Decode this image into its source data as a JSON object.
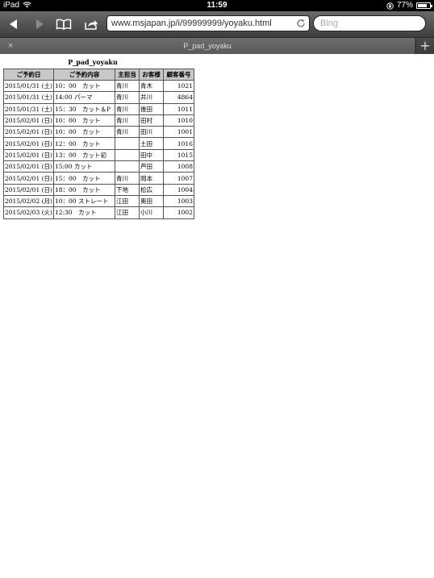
{
  "status_bar": {
    "device": "iPad",
    "time": "11:59",
    "battery": "77%",
    "battery_level_percent": 77
  },
  "toolbar": {
    "url": "www.msjapan.jp/i/99999999/yoyaku.html",
    "search_placeholder": "Bing"
  },
  "tabs": {
    "close": "×",
    "active_title": "P_pad_yoyaku",
    "add": "+"
  },
  "page": {
    "title": "P_pad_yoyaku",
    "columns": [
      "ご予約日",
      "ご予約内容",
      "主担当",
      "お客様",
      "顧客番号"
    ],
    "rows": [
      [
        "2015/01/31 (土)",
        "10：00　カット",
        "青川",
        "青木",
        "1021"
      ],
      [
        "2015/01/31 (土)",
        "14:00 パーマ",
        "青川",
        "井川",
        "4864"
      ],
      [
        "2015/01/31 (土)",
        "15：30　カット＆P",
        "青川",
        "後田",
        "1011"
      ],
      [
        "2015/02/01 (日)",
        "10：00　カット",
        "青川",
        "田村",
        "1010"
      ],
      [
        "2015/02/01 (日)",
        "10：00　カット",
        "青川",
        "田川",
        "1001"
      ],
      [
        "2015/02/01 (日)",
        "12：00　カット",
        "",
        "土田",
        "1016"
      ],
      [
        "2015/02/01 (日)",
        "13：00　カット初",
        "",
        "田中",
        "1015"
      ],
      [
        "2015/02/01 (日)",
        "15:00 カット",
        "",
        "芦田",
        "1008"
      ],
      [
        "2015/02/01 (日)",
        "15：00　カット",
        "青川",
        "岡本",
        "1007"
      ],
      [
        "2015/02/01 (日)",
        "18：00　カット",
        "下地",
        "松広",
        "1004"
      ],
      [
        "2015/02/02 (月)",
        "10：00 ストレート",
        "江田",
        "奥田",
        "1003"
      ],
      [
        "2015/02/03 (火)",
        "12:30　カット",
        "江田",
        "小川",
        "1002"
      ]
    ]
  }
}
